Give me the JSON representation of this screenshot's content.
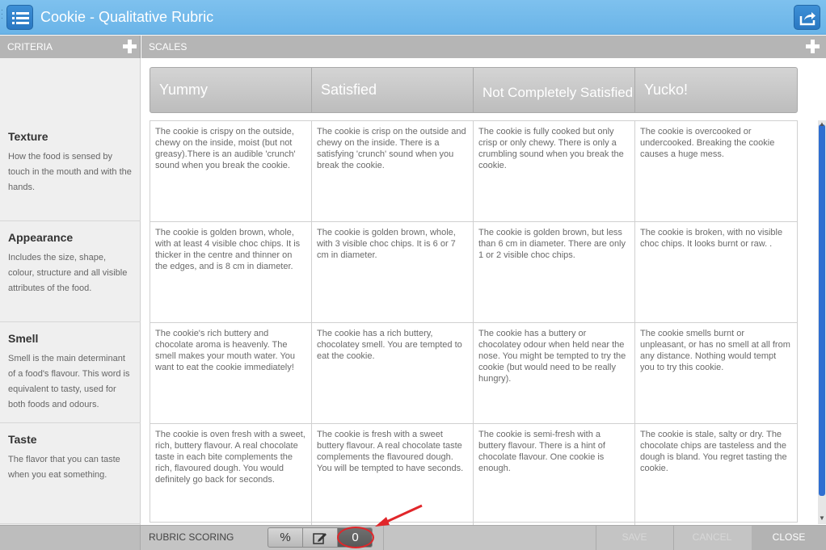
{
  "window": {
    "title": "Cookie - Qualitative Rubric"
  },
  "icons": {
    "menu": "list-icon",
    "share": "share-icon",
    "add_criterion": "plus-icon",
    "add_scale": "plus-icon",
    "percent": "percent-icon",
    "edit": "edit-icon"
  },
  "colors": {
    "titlebar": "#7ec1ee",
    "accent": "#2a78c2",
    "annotation": "#e1262a"
  },
  "headers": {
    "criteria": "CRITERIA",
    "scales": "SCALES"
  },
  "scales": [
    {
      "label": "Yummy"
    },
    {
      "label": "Satisfied"
    },
    {
      "label": "Not Completely Satisfied"
    },
    {
      "label": "Yucko!"
    }
  ],
  "criteria": [
    {
      "name": "Texture",
      "description": "How the food is sensed by touch in the mouth and with the hands.",
      "cells": [
        "The cookie is crispy on the outside, chewy on the inside, moist (but not greasy).There is an audible 'crunch' sound when you break the cookie.",
        "The cookie is crisp on the outside and chewy on the inside. There is a satisfying 'crunch' sound when you break the cookie.",
        "The cookie is fully cooked but only crisp or only chewy. There is only a crumbling sound when you break the cookie.",
        "The cookie is overcooked or undercooked. Breaking the cookie causes a huge mess."
      ]
    },
    {
      "name": "Appearance",
      "description": "Includes the size, shape, colour, structure and all visible attributes of the food.",
      "cells": [
        "The cookie is golden brown, whole, with at least 4 visible choc chips. It is thicker in the centre and thinner on the edges, and is 8 cm in diameter.",
        "The cookie is golden brown, whole, with 3 visible choc chips. It is 6 or 7 cm in diameter.",
        "The cookie is golden brown, but less than 6 cm in diameter. There are only 1 or 2 visible choc chips.",
        "The cookie is broken, with no visible choc chips. It looks burnt or raw. ."
      ]
    },
    {
      "name": "Smell",
      "description": "Smell is the main determinant of a food's flavour. This word is equivalent to tasty, used for both foods and odours.",
      "cells": [
        "The cookie's rich buttery and chocolate aroma is heavenly. The smell makes your mouth water. You want to eat the cookie immediately!",
        "The cookie has a rich buttery, chocolatey smell. You are tempted to eat the cookie.",
        "The cookie has a buttery or chocolatey odour when held near the nose. You might be tempted to try the cookie (but would need to be really hungry).",
        "The cookie smells burnt or unpleasant, or has no smell at all from any distance. Nothing would tempt you to try this cookie."
      ]
    },
    {
      "name": "Taste",
      "description": "The flavor that you can taste when you eat something.",
      "cells": [
        "The cookie is oven fresh with a sweet, rich, buttery flavour. A real chocolate taste in each bite complements the rich, flavoured dough. You would definitely go back for seconds.",
        "The cookie is fresh with a sweet buttery flavour. A real chocolate taste complements the flavoured dough. You will be tempted to have seconds.",
        "The cookie is semi-fresh with a buttery flavour. There is a hint of chocolate flavour. One cookie is enough.",
        "The cookie is stale, salty or dry. The chocolate chips are tasteless and the dough is bland. You regret tasting the cookie."
      ]
    }
  ],
  "footer": {
    "rubric_scoring_label": "RUBRIC SCORING",
    "percent_label": "%",
    "score_value": "0",
    "save_label": "SAVE",
    "cancel_label": "CANCEL",
    "close_label": "CLOSE"
  }
}
